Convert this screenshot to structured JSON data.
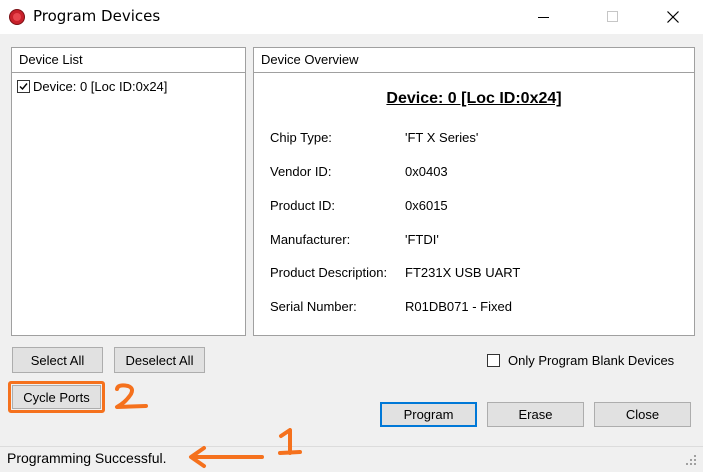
{
  "window": {
    "title": "Program Devices",
    "minimize_icon": "minimize-icon",
    "maximize_icon": "maximize-icon",
    "close_icon": "close-icon"
  },
  "device_list": {
    "header": "Device List",
    "items": [
      {
        "label": "Device: 0 [Loc ID:0x24]",
        "checked": true
      }
    ]
  },
  "device_overview": {
    "header": "Device Overview",
    "title": "Device: 0 [Loc ID:0x24]",
    "fields": [
      {
        "label": "Chip Type:",
        "value": "'FT X Series'"
      },
      {
        "label": "Vendor ID:",
        "value": "0x0403"
      },
      {
        "label": "Product ID:",
        "value": "0x6015"
      },
      {
        "label": "Manufacturer:",
        "value": "'FTDI'"
      },
      {
        "label": "Product Description:",
        "value": "FT231X USB UART"
      },
      {
        "label": "Serial Number:",
        "value": "R01DB071 - Fixed"
      }
    ]
  },
  "buttons": {
    "select_all": "Select All",
    "deselect_all": "Deselect All",
    "cycle_ports": "Cycle Ports",
    "program": "Program",
    "erase": "Erase",
    "close": "Close"
  },
  "options": {
    "only_program_blank_label": "Only Program Blank Devices",
    "only_program_blank_checked": false
  },
  "status": {
    "text": "Programming Successful."
  },
  "annotations": {
    "color": "#f5711d",
    "marker_1": "1",
    "marker_2": "2"
  }
}
